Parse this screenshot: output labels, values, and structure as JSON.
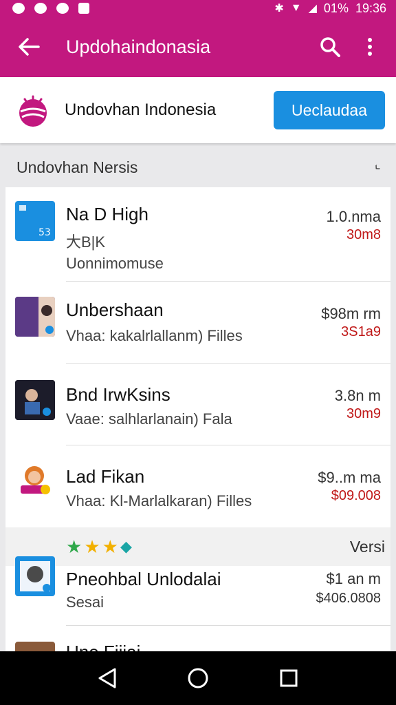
{
  "status_bar": {
    "time": "19:36",
    "battery": "01%"
  },
  "app_bar": {
    "title": "Updohaindonasia"
  },
  "header": {
    "name": "Undovhan Indonesia",
    "action_label": "Ueclaudaa"
  },
  "section": {
    "title": "Undovhan Nersis"
  },
  "list": {
    "items": [
      {
        "title": "Na D High",
        "subtitle": "大B|K",
        "meta": "Uonnimomuse",
        "right_top": "1.0.nma",
        "right_bottom": "30m8",
        "icon": "blue-square-app-icon"
      },
      {
        "title": "Unbershaan",
        "subtitle": "Vhaa: kakalrlallanm) Filles",
        "right_top": "$98m rm",
        "right_bottom": "3S1a9",
        "icon": "purple-photo-app-icon"
      },
      {
        "title": "Bnd IrwKsins",
        "subtitle": "Vaae: salhlarlanain) Fala",
        "right_top": "3.8n m",
        "right_bottom": "30m9",
        "icon": "dark-photo-app-icon"
      },
      {
        "title": "Lad Fikan",
        "subtitle": "Vhaa: Kl-Marlalkaran) Filles",
        "right_top": "$9..m ma",
        "right_bottom": "$09.008",
        "icon": "avatar-app-icon"
      },
      {
        "title": "Pneohbal Unlodalai",
        "subtitle": "Sesai",
        "right_top": "$1 an m",
        "right_bottom": "$406.0808",
        "icon": "blue-frame-app-icon"
      }
    ],
    "rating_strip": {
      "label": "Versi"
    },
    "partial_item": {
      "title": "Une Fiijai"
    }
  },
  "colors": {
    "brand": "#c2187f",
    "accent_blue": "#1a8fe0",
    "price_red": "#c01818"
  }
}
